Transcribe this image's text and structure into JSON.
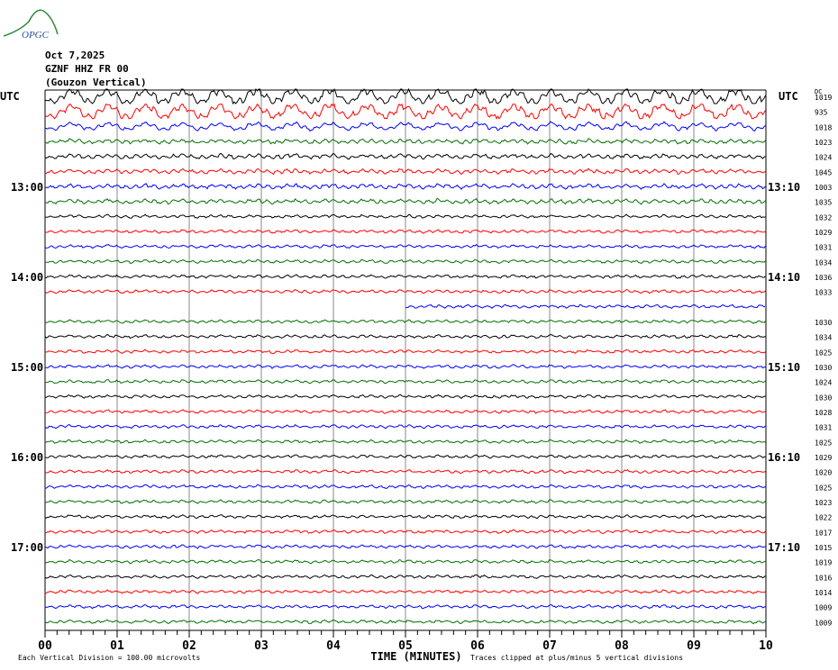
{
  "header": {
    "logo_text": "OPGC",
    "date": "Oct 7,2025",
    "station": "GZNF HHZ FR 00",
    "location": "(Gouzon Vertical)"
  },
  "chart_data": {
    "type": "line",
    "title": "GZNF HHZ FR 00 helicorder",
    "xlabel": "TIME (MINUTES)",
    "xlim": [
      0,
      10
    ],
    "x_ticks": [
      "00",
      "01",
      "02",
      "03",
      "04",
      "05",
      "06",
      "07",
      "08",
      "09",
      "10"
    ],
    "left_axis_label": "UTC",
    "right_axis_label": "UTC",
    "dc_label": "DC",
    "left_hour_labels": [
      {
        "row": 6,
        "text": "13:00"
      },
      {
        "row": 12,
        "text": "14:00"
      },
      {
        "row": 18,
        "text": "15:00"
      },
      {
        "row": 24,
        "text": "16:00"
      },
      {
        "row": 30,
        "text": "17:00"
      }
    ],
    "right_hour_labels": [
      {
        "row": 6,
        "text": "13:10"
      },
      {
        "row": 12,
        "text": "14:10"
      },
      {
        "row": 18,
        "text": "15:10"
      },
      {
        "row": 24,
        "text": "16:10"
      },
      {
        "row": 30,
        "text": "17:10"
      }
    ],
    "trace_colors": [
      "#000000",
      "#ff0000",
      "#0000ff",
      "#007000"
    ],
    "rows_dc": [
      "1019",
      "935",
      "1018",
      "1023",
      "1024",
      "1045",
      "1003",
      "1035",
      "1032",
      "1029",
      "1031",
      "1034",
      "1036",
      "1033",
      "",
      "1030",
      "1034",
      "1025",
      "1030",
      "1024",
      "1030",
      "1028",
      "1031",
      "1025",
      "1029",
      "1020",
      "1025",
      "1023",
      "1022",
      "1017",
      "1015",
      "1019",
      "1016",
      "1014",
      "1009",
      "1009"
    ],
    "gap": {
      "row": 14,
      "from_minute": 0,
      "to_minute": 5
    },
    "footer_left": "Each Vertical Division =  100.00 microvolts",
    "footer_right": "Traces clipped at plus/minus 5 vertical divisions"
  }
}
